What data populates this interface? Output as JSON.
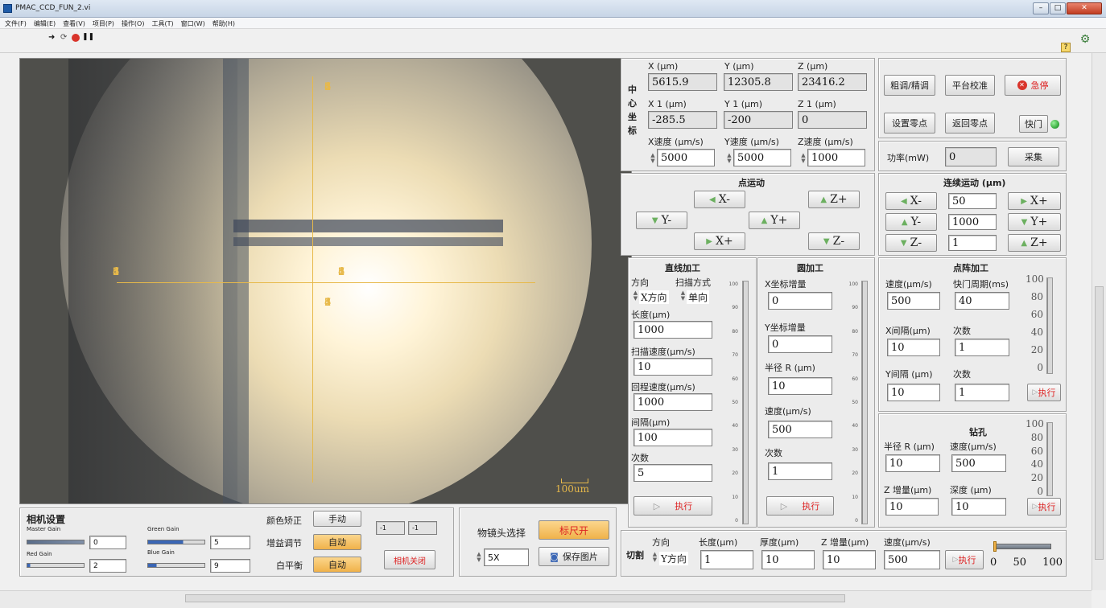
{
  "window": {
    "title": "PMAC_CCD_FUN_2.vi"
  },
  "menu": [
    "文件(F)",
    "编辑(E)",
    "查看(V)",
    "项目(P)",
    "操作(O)",
    "工具(T)",
    "窗口(W)",
    "帮助(H)"
  ],
  "camera": {
    "scale_label": "100um",
    "axis_x_left": [
      "7",
      "6",
      "5",
      "4",
      "3",
      "2",
      "1"
    ],
    "axis_x_right": [
      "1",
      "2",
      "3",
      "4",
      "5",
      "6",
      "7"
    ],
    "axis_y_top": [
      "7",
      "6",
      "5",
      "4",
      "3",
      "2",
      "1"
    ],
    "axis_y_bottom": [
      "1",
      "2",
      "3",
      "4",
      "5",
      "6",
      "7"
    ]
  },
  "camera_settings": {
    "title": "相机设置",
    "master_gain_label": "Master Gain",
    "master_gain": "0",
    "green_gain_label": "Green Gain",
    "green_gain": "5",
    "red_gain_label": "Red Gain",
    "red_gain": "2",
    "blue_gain_label": "Blue Gain",
    "blue_gain": "9",
    "color_correct_label": "颜色矫正",
    "color_correct_btn": "手动",
    "gain_adjust_label": "增益调节",
    "gain_adjust_btn": "自动",
    "white_balance_label": "白平衡",
    "white_balance_btn": "自动",
    "res1": "-1",
    "res2": "-1",
    "camera_close": "相机关闭"
  },
  "objective": {
    "label": "物镜头选择",
    "value": "5X",
    "ruler_btn": "标尺开",
    "save_btn": "保存图片"
  },
  "center": {
    "side_label": "中心坐标",
    "x_label": "X (μm)",
    "y_label": "Y (μm)",
    "z_label": "Z (μm)",
    "x": "5615.9",
    "y": "12305.8",
    "z": "23416.2",
    "x1_label": "X 1 (μm)",
    "y1_label": "Y 1 (μm)",
    "z1_label": "Z 1 (μm)",
    "x1": "-285.5",
    "y1": "-200",
    "z1": "0",
    "xs_label": "X速度 (μm/s)",
    "ys_label": "Y速度 (μm/s)",
    "zs_label": "Z速度 (μm/s)",
    "xs": "5000",
    "ys": "5000",
    "zs": "1000"
  },
  "control": {
    "coarse": "粗调/精调",
    "calib": "平台校准",
    "estop": "急停",
    "set_zero": "设置零点",
    "return_zero": "返回零点",
    "shutter": "快门",
    "power_label": "功率(mW)",
    "power": "0",
    "collect": "采集"
  },
  "point_motion": {
    "title": "点运动",
    "xm": "X-",
    "zp": "Z+",
    "ym": "Y-",
    "yp": "Y+",
    "xp": "X+",
    "zm": "Z-"
  },
  "cont_motion": {
    "title": "连续运动 (μm)",
    "xm": "X-",
    "xv": "50",
    "xp": "X+",
    "ym": "Y-",
    "yv": "1000",
    "yp": "Y+",
    "zm": "Z-",
    "zv": "1",
    "zp": "Z+"
  },
  "line": {
    "title": "直线加工",
    "dir_label": "方向",
    "scan_label": "扫描方式",
    "dir": "X方向",
    "scan": "单向",
    "len_label": "长度(μm)",
    "len": "1000",
    "speed_label": "扫描速度(μm/s)",
    "speed": "10",
    "ret_label": "回程速度(μm/s)",
    "ret": "1000",
    "gap_label": "间隔(μm)",
    "gap": "100",
    "count_label": "次数",
    "count": "5",
    "exec": "执行",
    "gauge_ticks": [
      "100",
      "90",
      "80",
      "70",
      "60",
      "50",
      "40",
      "30",
      "20",
      "10",
      "0"
    ]
  },
  "circle": {
    "title": "圆加工",
    "xinc_label": "X坐标增量",
    "xinc": "0",
    "yinc_label": "Y坐标增量",
    "yinc": "0",
    "r_label": "半径 R (μm)",
    "r": "10",
    "speed_label": "速度(μm/s)",
    "speed": "500",
    "count_label": "次数",
    "count": "1",
    "exec": "执行",
    "gauge_ticks": [
      "100",
      "90",
      "80",
      "70",
      "60",
      "50",
      "40",
      "30",
      "20",
      "10",
      "0"
    ]
  },
  "dot_array": {
    "title": "点阵加工",
    "speed_label": "速度(μm/s)",
    "speed": "500",
    "period_label": "快门周期(ms)",
    "period": "40",
    "xgap_label": "X间隔(μm)",
    "xgap": "10",
    "xcount_label": "次数",
    "xcount": "1",
    "ygap_label": "Y间隔 (μm)",
    "ygap": "10",
    "ycount_label": "次数",
    "ycount": "1",
    "exec": "执行",
    "gauge_ticks": [
      "100",
      "80",
      "60",
      "40",
      "20",
      "0"
    ]
  },
  "drill": {
    "title": "钻孔",
    "r_label": "半径 R (μm)",
    "r": "10",
    "speed_label": "速度(μm/s)",
    "speed": "500",
    "zinc_label": "Z 增量(μm)",
    "zinc": "10",
    "depth_label": "深度 (μm)",
    "depth": "10",
    "exec": "执行",
    "gauge_ticks": [
      "100",
      "80",
      "60",
      "40",
      "20",
      "0"
    ]
  },
  "cut": {
    "title": "切割",
    "dir_label": "方向",
    "dir": "Y方向",
    "len_label": "长度(μm)",
    "len": "1",
    "thick_label": "厚度(μm)",
    "thick": "10",
    "zinc_label": "Z 增量(μm)",
    "zinc": "10",
    "speed_label": "速度(μm/s)",
    "speed": "500",
    "exec": "执行",
    "slider_ticks": [
      "0",
      "50",
      "100"
    ],
    "slider_value": 0
  },
  "colors": {
    "accent_orange": "#f6c26b",
    "stop_red": "#d9342b",
    "led_green": "#3cb043",
    "crosshair": "#e7b94a"
  }
}
